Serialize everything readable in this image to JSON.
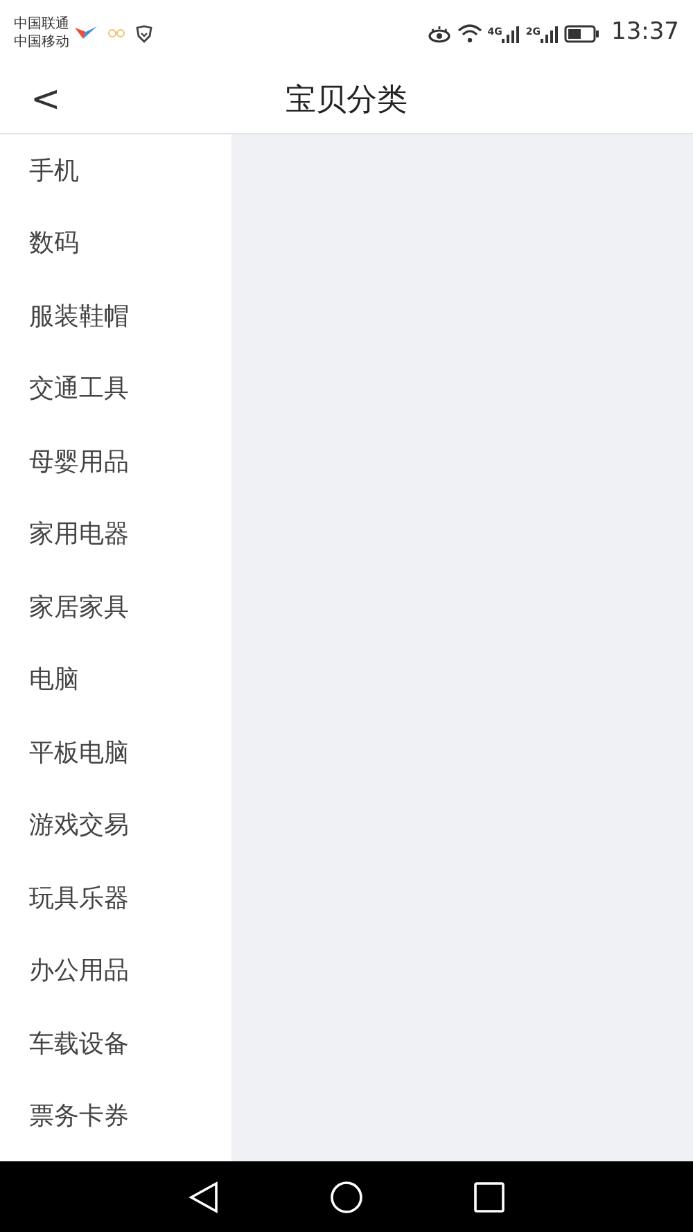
{
  "status_bar": {
    "carriers": [
      "中国联通",
      "中国移动"
    ],
    "network_1": "4G",
    "network_2": "2G",
    "time": "13:37"
  },
  "header": {
    "back": "<",
    "title": "宝贝分类"
  },
  "categories": [
    {
      "label": "手机"
    },
    {
      "label": "数码"
    },
    {
      "label": "服装鞋帽"
    },
    {
      "label": "交通工具"
    },
    {
      "label": "母婴用品"
    },
    {
      "label": "家用电器"
    },
    {
      "label": "家居家具"
    },
    {
      "label": "电脑"
    },
    {
      "label": "平板电脑"
    },
    {
      "label": "游戏交易"
    },
    {
      "label": "玩具乐器"
    },
    {
      "label": "办公用品"
    },
    {
      "label": "车载设备"
    },
    {
      "label": "票务卡券"
    }
  ]
}
